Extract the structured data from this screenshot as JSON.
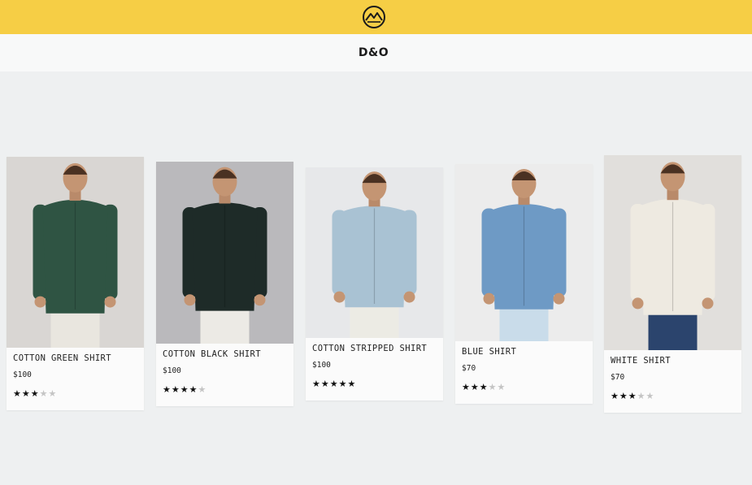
{
  "header": {
    "logo_icon": "mountain-circle-logo-icon",
    "brand": "D&O",
    "accent_color": "#f6ce45"
  },
  "products": [
    {
      "name": "COTTON GREEN SHIRT",
      "price": "$100",
      "rating": 3,
      "max_rating": 5,
      "shirt_color": "#2f5443",
      "bottom_color": "#e9e6df",
      "bg_color": "#d9d6d3"
    },
    {
      "name": "COTTON BLACK SHIRT",
      "price": "$100",
      "rating": 4,
      "max_rating": 5,
      "shirt_color": "#1e2b28",
      "bottom_color": "#eceae5",
      "bg_color": "#bab9bc"
    },
    {
      "name": "COTTON STRIPPED SHIRT",
      "price": "$100",
      "rating": 5,
      "max_rating": 5,
      "shirt_color": "#a9c2d3",
      "bottom_color": "#ecebe4",
      "bg_color": "#e7e8ea"
    },
    {
      "name": "BLUE SHIRT",
      "price": "$70",
      "rating": 3,
      "max_rating": 5,
      "shirt_color": "#6e9ac5",
      "bottom_color": "#c9dcea",
      "bg_color": "#ececec"
    },
    {
      "name": "WHITE SHIRT",
      "price": "$70",
      "rating": 3,
      "max_rating": 5,
      "shirt_color": "#eeeae1",
      "bottom_color": "#2b446d",
      "bg_color": "#e1dfdc"
    }
  ]
}
